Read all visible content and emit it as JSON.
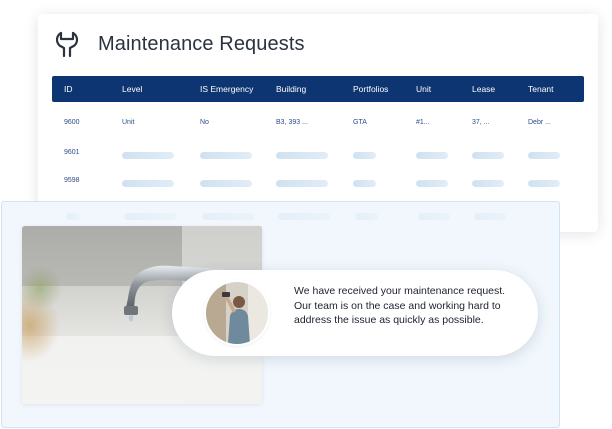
{
  "header": {
    "title": "Maintenance Requests",
    "icon": "wrench-icon"
  },
  "table": {
    "columns": [
      "ID",
      "Level",
      "IS Emergency",
      "Building",
      "Portfolios",
      "Unit",
      "Lease",
      "Tenant"
    ],
    "rows": [
      {
        "id": "9600",
        "level": "Unit",
        "emergency": "No",
        "building": "B3, 393 ...",
        "portfolio": "GTA",
        "unit": "#1...",
        "lease": "37, ...",
        "tenant": "Debr ..."
      },
      {
        "id": "9601"
      },
      {
        "id": "9598"
      }
    ]
  },
  "notification": {
    "message": "We have received your maintenance request. Our team is on the case and working hard to address the issue as quickly as possible."
  },
  "colors": {
    "header_bg": "#0c3571",
    "accent_text": "#2d4e8a",
    "skeleton": "#d6e6f4"
  }
}
